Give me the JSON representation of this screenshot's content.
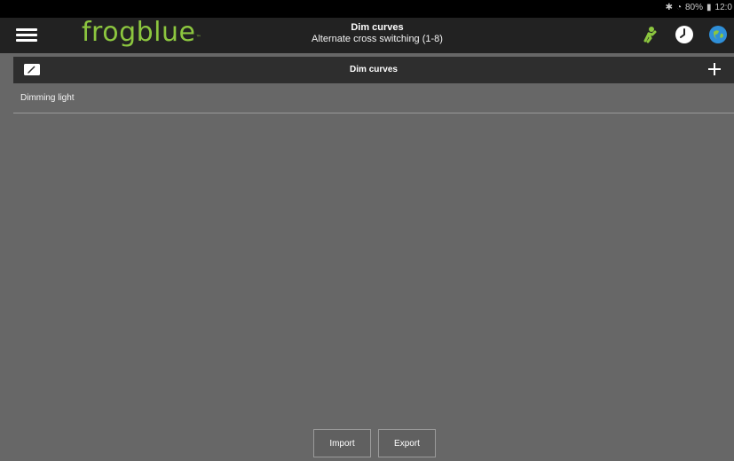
{
  "status_bar": {
    "bluetooth_icon": "bluetooth-icon",
    "wifi_icon": "wifi-icon",
    "battery": "80%",
    "time": "12:0"
  },
  "app_bar": {
    "logo_text": "frogblue",
    "logo_tm": "™",
    "title": "Dim curves",
    "subtitle": "Alternate cross switching (1-8)",
    "icons": [
      "person-icon",
      "clock-icon",
      "globe-icon"
    ],
    "accent_color": "#8cc63f"
  },
  "section": {
    "title": "Dim curves"
  },
  "list": {
    "items": [
      {
        "label": "Dimming light"
      }
    ]
  },
  "footer": {
    "import_label": "Import",
    "export_label": "Export"
  }
}
